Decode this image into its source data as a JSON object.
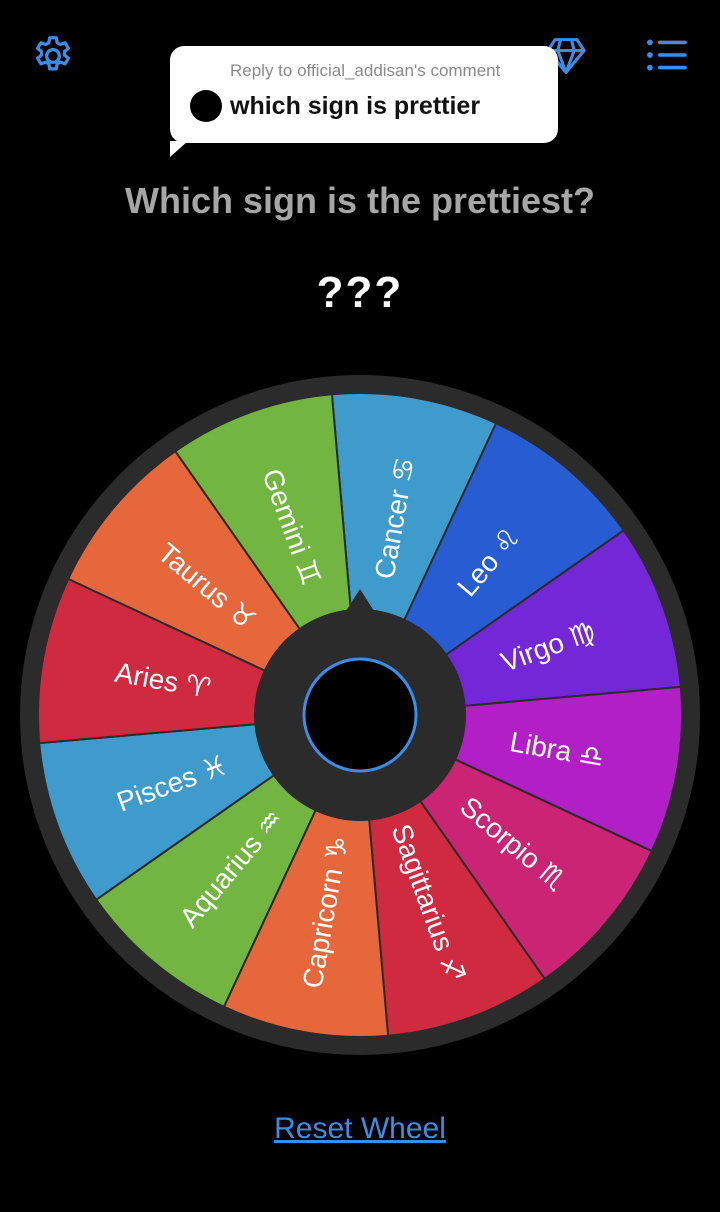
{
  "toolbar": {
    "settings_icon": "gear-icon",
    "gem_icon": "gem-icon",
    "menu_icon": "list-icon",
    "accent_color": "#3b8de8"
  },
  "comment": {
    "reply_label": "Reply to official_addisan's comment",
    "text": "which sign is prettier"
  },
  "question": "Which sign is the prettiest?",
  "result": "???",
  "wheel": {
    "segments": [
      {
        "label": "Cancer",
        "symbol": "♋",
        "color": "#3f9bcc"
      },
      {
        "label": "Leo",
        "symbol": "♌",
        "color": "#275cd3"
      },
      {
        "label": "Virgo",
        "symbol": "♍",
        "color": "#7427d6"
      },
      {
        "label": "Libra",
        "symbol": "♎",
        "color": "#b21fc7"
      },
      {
        "label": "Scorpio",
        "symbol": "♏",
        "color": "#cb2474"
      },
      {
        "label": "Sagittarius",
        "symbol": "♐",
        "color": "#d02a41"
      },
      {
        "label": "Capricorn",
        "symbol": "♑",
        "color": "#e7673d"
      },
      {
        "label": "Aquarius",
        "symbol": "♒",
        "color": "#72b540"
      },
      {
        "label": "Pisces",
        "symbol": "♓",
        "color": "#3f9bcc"
      },
      {
        "label": "Aries",
        "symbol": "♈",
        "color": "#d02a41"
      },
      {
        "label": "Taurus",
        "symbol": "♉",
        "color": "#e7673d"
      },
      {
        "label": "Gemini",
        "symbol": "♊",
        "color": "#72b540"
      }
    ]
  },
  "reset_label": "Reset Wheel"
}
